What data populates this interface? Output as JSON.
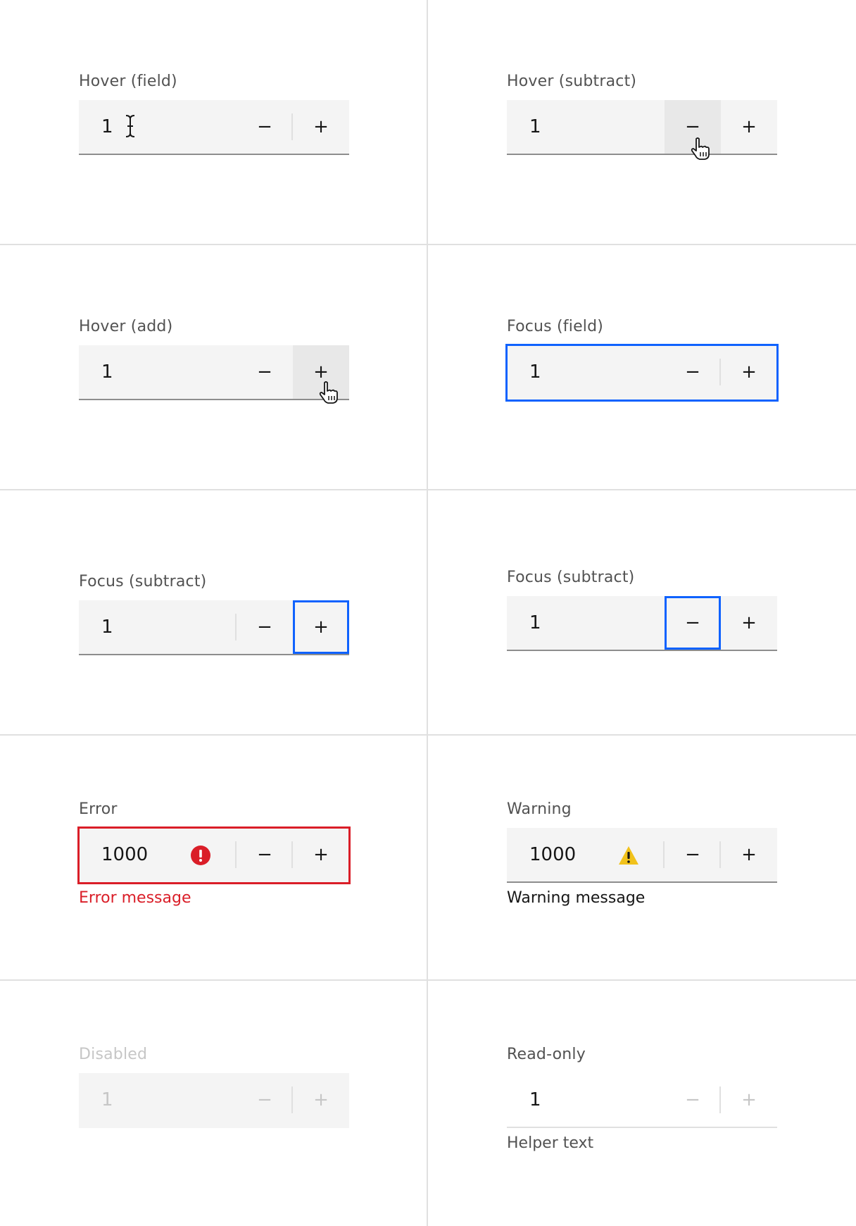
{
  "cells": [
    {
      "label": "Hover (field)",
      "value": "1",
      "subtract_label": "−",
      "add_label": "+"
    },
    {
      "label": "Hover (subtract)",
      "value": "1",
      "subtract_label": "−",
      "add_label": "+"
    },
    {
      "label": "Hover (add)",
      "value": "1",
      "subtract_label": "−",
      "add_label": "+"
    },
    {
      "label": "Focus (field)",
      "value": "1",
      "subtract_label": "−",
      "add_label": "+"
    },
    {
      "label": "Focus (subtract)",
      "value": "1",
      "subtract_label": "−",
      "add_label": "+"
    },
    {
      "label": "Focus (subtract)",
      "value": "1",
      "subtract_label": "−",
      "add_label": "+"
    },
    {
      "label": "Error",
      "value": "1000",
      "subtract_label": "−",
      "add_label": "+",
      "message": "Error message"
    },
    {
      "label": "Warning",
      "value": "1000",
      "subtract_label": "−",
      "add_label": "+",
      "message": "Warning message"
    },
    {
      "label": "Disabled",
      "value": "1",
      "subtract_label": "−",
      "add_label": "+"
    },
    {
      "label": "Read-only",
      "value": "1",
      "subtract_label": "−",
      "add_label": "+",
      "message": "Helper text"
    }
  ],
  "colors": {
    "focus": "#0f62fe",
    "error": "#da1e28",
    "warning": "#f1c21b",
    "field_bg": "#f4f4f4",
    "hover_bg": "#e8e8e8"
  },
  "icons": {
    "error": "error-filled-icon",
    "warning": "warning-triangle-icon",
    "text_cursor": "i-beam-cursor-icon",
    "pointer": "hand-pointer-icon"
  }
}
